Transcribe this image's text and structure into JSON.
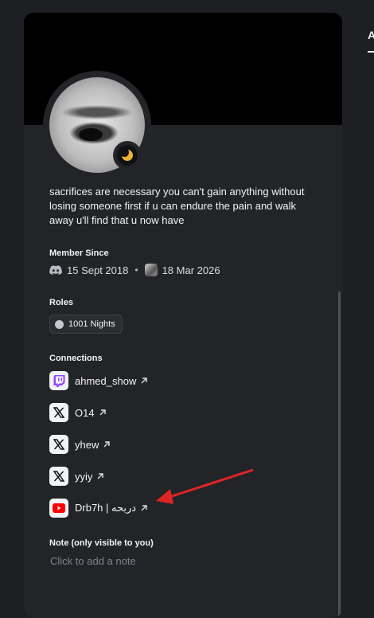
{
  "side_tab": {
    "label": "A"
  },
  "profile": {
    "bio": "sacrifices are necessary you can't gain anything without losing someone first if u can endure the pain and walk away u'll find that u now have",
    "member_since": {
      "title": "Member Since",
      "discord_date": "15 Sept 2018",
      "server_date": "18 Mar 2026"
    },
    "roles": {
      "title": "Roles",
      "items": [
        {
          "label": "1001 Nights",
          "color": "#c4c9ce"
        }
      ]
    },
    "connections": {
      "title": "Connections",
      "items": [
        {
          "platform": "twitch-icon",
          "name": "ahmed_show"
        },
        {
          "platform": "x-icon",
          "name": "O14"
        },
        {
          "platform": "x-icon",
          "name": "yhew"
        },
        {
          "platform": "x-icon",
          "name": "yyiy"
        },
        {
          "platform": "youtube-icon",
          "name": "Drb7h | دربحه"
        }
      ]
    },
    "note": {
      "title": "Note (only visible to you)",
      "placeholder": "Click to add a note"
    }
  },
  "colors": {
    "panel": "#232428",
    "banner": "#000000",
    "status_idle": "#f0b232",
    "annotation_arrow": "#e02424"
  }
}
